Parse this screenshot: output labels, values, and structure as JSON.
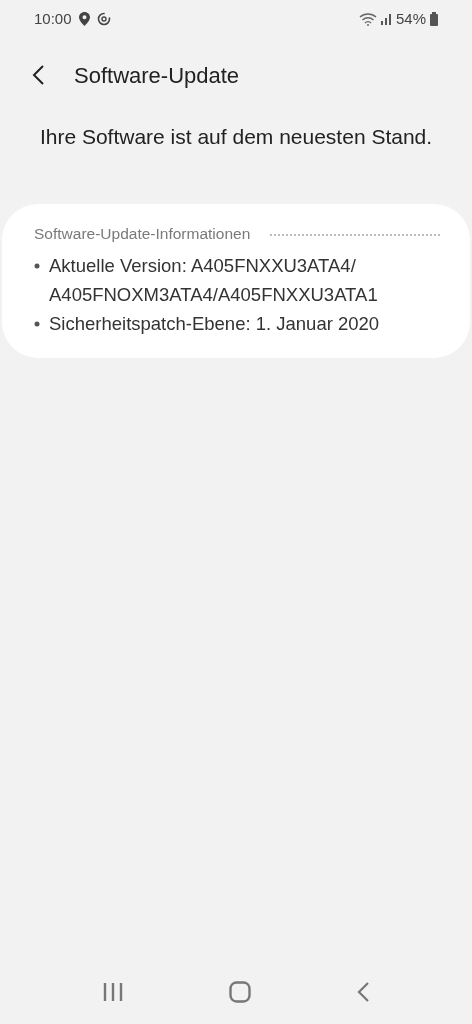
{
  "status_bar": {
    "time": "10:00",
    "battery": "54%"
  },
  "header": {
    "title": "Software-Update"
  },
  "message": "Ihre Software ist auf dem neuesten Stand.",
  "info_card": {
    "heading": "Software-Update-Informationen",
    "items": [
      "Aktuelle Version: A405FNXXU3ATA4/ A405FNOXM3ATA4/A405FNXXU3ATA1",
      "Sicherheitspatch-Ebene: 1. Januar 2020"
    ]
  }
}
